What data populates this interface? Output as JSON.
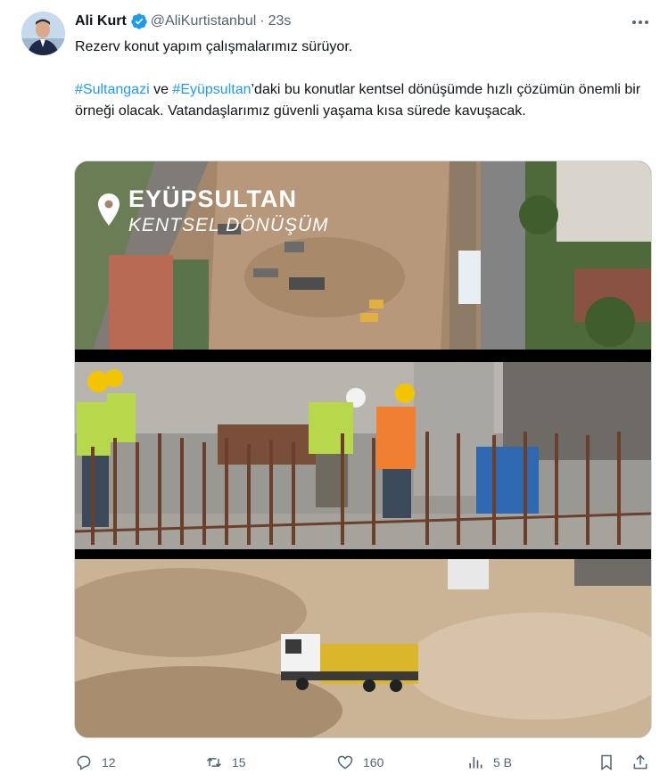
{
  "tweet": {
    "author_name": "Ali Kurt",
    "handle": "@AliKurtistanbul",
    "separator": "·",
    "time": "23s",
    "line1": "Rezerv konut yapım çalışmalarımız sürüyor.",
    "hashtag1": "#Sultangazi",
    "connector": " ve ",
    "hashtag2": "#Eyüpsultan",
    "line2_rest": "’daki bu konutlar kentsel dönüşümde hızlı çözümün önemli bir örneği olacak. Vatandaşlarımız güvenli yaşama kısa sürede kavuşacak."
  },
  "media": {
    "overlay_title": "EYÜPSULTAN",
    "overlay_subtitle": "KENTSEL DÖNÜŞÜM"
  },
  "actions": {
    "replies": "12",
    "reposts": "15",
    "likes": "160",
    "views": "5 B"
  },
  "colors": {
    "link": "#1d9bf0",
    "verified": "#1d9bf0",
    "secondary_text": "#536471"
  },
  "icons": [
    "verified-badge-icon",
    "more-icon",
    "location-pin-icon",
    "reply-icon",
    "repost-icon",
    "like-icon",
    "views-icon",
    "bookmark-icon",
    "share-icon"
  ]
}
